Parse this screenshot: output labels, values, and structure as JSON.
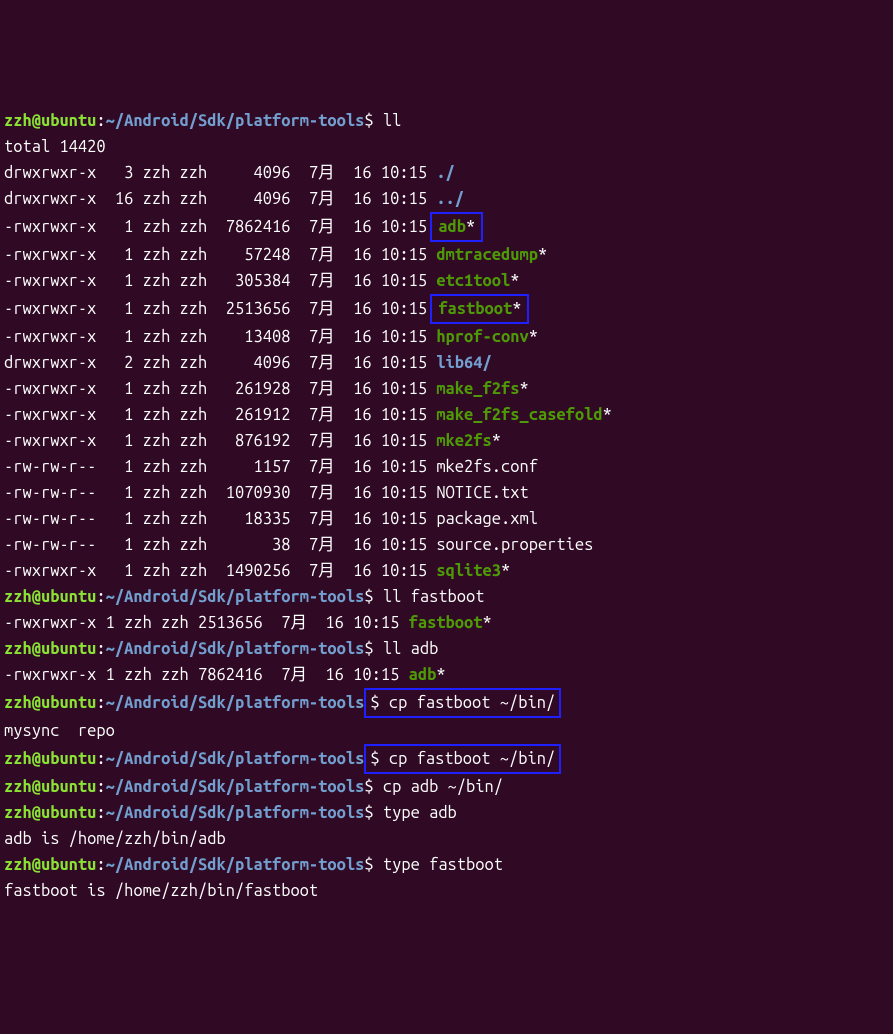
{
  "prompt": {
    "user": "zzh@ubuntu",
    "colon": ":",
    "path": "~/Android/Sdk/platform-tools",
    "dollar": "$"
  },
  "cmd": {
    "ll": "ll",
    "ll_fastboot": "ll fastboot",
    "ll_adb": "ll adb",
    "cp_fastboot": "cp fastboot ~/bin/",
    "cp_adb": "cp adb ~/bin/",
    "type_adb": "type adb",
    "type_fastboot": "type fastboot"
  },
  "total": "total 14420",
  "rows": [
    {
      "perm": "drwxrwxr-x",
      "links": " 3",
      "user": "zzh",
      "group": "zzh",
      "size": "    4096",
      "month": " 7月",
      "day": " 16",
      "time": "10:15",
      "name": "./",
      "color": "dir"
    },
    {
      "perm": "drwxrwxr-x",
      "links": "16",
      "user": "zzh",
      "group": "zzh",
      "size": "    4096",
      "month": " 7月",
      "day": " 16",
      "time": "10:15",
      "name": "../",
      "color": "dir"
    },
    {
      "perm": "-rwxrwxr-x",
      "links": " 1",
      "user": "zzh",
      "group": "zzh",
      "size": " 7862416",
      "month": " 7月",
      "day": " 16",
      "time": "10:15",
      "name": "adb",
      "suffix": "*",
      "color": "exe"
    },
    {
      "perm": "-rwxrwxr-x",
      "links": " 1",
      "user": "zzh",
      "group": "zzh",
      "size": "   57248",
      "month": " 7月",
      "day": " 16",
      "time": "10:15",
      "name": "dmtracedump",
      "suffix": "*",
      "color": "exe"
    },
    {
      "perm": "-rwxrwxr-x",
      "links": " 1",
      "user": "zzh",
      "group": "zzh",
      "size": "  305384",
      "month": " 7月",
      "day": " 16",
      "time": "10:15",
      "name": "etc1tool",
      "suffix": "*",
      "color": "exe"
    },
    {
      "perm": "-rwxrwxr-x",
      "links": " 1",
      "user": "zzh",
      "group": "zzh",
      "size": " 2513656",
      "month": " 7月",
      "day": " 16",
      "time": "10:15",
      "name": "fastboot",
      "suffix": "*",
      "color": "exe"
    },
    {
      "perm": "-rwxrwxr-x",
      "links": " 1",
      "user": "zzh",
      "group": "zzh",
      "size": "   13408",
      "month": " 7月",
      "day": " 16",
      "time": "10:15",
      "name": "hprof-conv",
      "suffix": "*",
      "color": "exe"
    },
    {
      "perm": "drwxrwxr-x",
      "links": " 2",
      "user": "zzh",
      "group": "zzh",
      "size": "    4096",
      "month": " 7月",
      "day": " 16",
      "time": "10:15",
      "name": "lib64/",
      "color": "dir"
    },
    {
      "perm": "-rwxrwxr-x",
      "links": " 1",
      "user": "zzh",
      "group": "zzh",
      "size": "  261928",
      "month": " 7月",
      "day": " 16",
      "time": "10:15",
      "name": "make_f2fs",
      "suffix": "*",
      "color": "exe"
    },
    {
      "perm": "-rwxrwxr-x",
      "links": " 1",
      "user": "zzh",
      "group": "zzh",
      "size": "  261912",
      "month": " 7月",
      "day": " 16",
      "time": "10:15",
      "name": "make_f2fs_casefold",
      "suffix": "*",
      "color": "exe"
    },
    {
      "perm": "-rwxrwxr-x",
      "links": " 1",
      "user": "zzh",
      "group": "zzh",
      "size": "  876192",
      "month": " 7月",
      "day": " 16",
      "time": "10:15",
      "name": "mke2fs",
      "suffix": "*",
      "color": "exe"
    },
    {
      "perm": "-rw-rw-r--",
      "links": " 1",
      "user": "zzh",
      "group": "zzh",
      "size": "    1157",
      "month": " 7月",
      "day": " 16",
      "time": "10:15",
      "name": "mke2fs.conf",
      "color": "white"
    },
    {
      "perm": "-rw-rw-r--",
      "links": " 1",
      "user": "zzh",
      "group": "zzh",
      "size": " 1070930",
      "month": " 7月",
      "day": " 16",
      "time": "10:15",
      "name": "NOTICE.txt",
      "color": "white"
    },
    {
      "perm": "-rw-rw-r--",
      "links": " 1",
      "user": "zzh",
      "group": "zzh",
      "size": "   18335",
      "month": " 7月",
      "day": " 16",
      "time": "10:15",
      "name": "package.xml",
      "color": "white"
    },
    {
      "perm": "-rw-rw-r--",
      "links": " 1",
      "user": "zzh",
      "group": "zzh",
      "size": "      38",
      "month": " 7月",
      "day": " 16",
      "time": "10:15",
      "name": "source.properties",
      "color": "white"
    },
    {
      "perm": "-rwxrwxr-x",
      "links": " 1",
      "user": "zzh",
      "group": "zzh",
      "size": " 1490256",
      "month": " 7月",
      "day": " 16",
      "time": "10:15",
      "name": "sqlite3",
      "suffix": "*",
      "color": "exe"
    }
  ],
  "single": {
    "fastboot": {
      "perm": "-rwxrwxr-x",
      "links": "1",
      "user": "zzh",
      "group": "zzh",
      "size": "2513656",
      "month": " 7月",
      "day": " 16",
      "time": "10:15",
      "name": "fastboot",
      "suffix": "*",
      "color": "exe"
    },
    "adb": {
      "perm": "-rwxrwxr-x",
      "links": "1",
      "user": "zzh",
      "group": "zzh",
      "size": "7862416",
      "month": " 7月",
      "day": " 16",
      "time": "10:15",
      "name": "adb",
      "suffix": "*",
      "color": "exe"
    }
  },
  "tabcomplete": "mysync  repo",
  "type_results": {
    "adb": "adb is /home/zzh/bin/adb",
    "fastboot": "fastboot is /home/zzh/bin/fastboot"
  },
  "highlight_boxes_on_rows": [
    2,
    5
  ],
  "highlight_cp_commands": true
}
